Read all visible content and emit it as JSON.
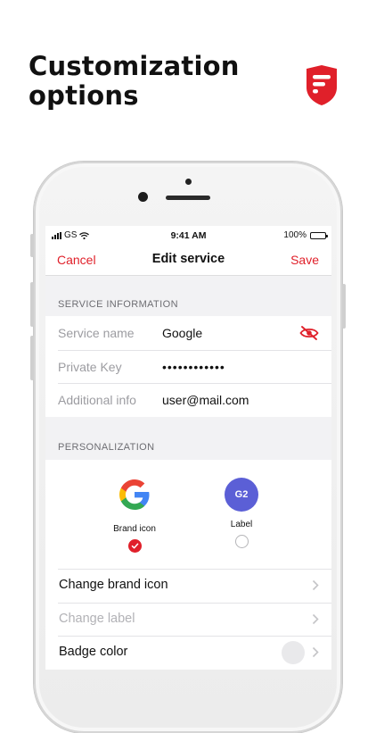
{
  "headline": {
    "line1": "Customization",
    "line2": "options"
  },
  "brand": {
    "logo_icon": "shield-logo-icon",
    "accent": "#e0202a"
  },
  "status_bar": {
    "carrier": "GS",
    "time": "9:41 AM",
    "battery": "100%"
  },
  "nav": {
    "cancel": "Cancel",
    "title": "Edit service",
    "save": "Save"
  },
  "service_info": {
    "header": "SERVICE INFORMATION",
    "rows": [
      {
        "label": "Service name",
        "value": "Google",
        "icon": "eye-slash-icon"
      },
      {
        "label": "Private Key",
        "value": "••••••••••••"
      },
      {
        "label": "Additional info",
        "value": "user@mail.com"
      }
    ]
  },
  "personalization": {
    "header": "PERSONALIZATION",
    "options": [
      {
        "label": "Brand icon",
        "icon": "google-g-icon",
        "selected": true
      },
      {
        "label": "Label",
        "badge_text": "G2",
        "badge_color": "#5b5fd6",
        "selected": false
      }
    ],
    "rows": [
      {
        "label": "Change brand icon",
        "enabled": true
      },
      {
        "label": "Change label",
        "enabled": false
      },
      {
        "label": "Badge color",
        "enabled": true
      }
    ]
  }
}
